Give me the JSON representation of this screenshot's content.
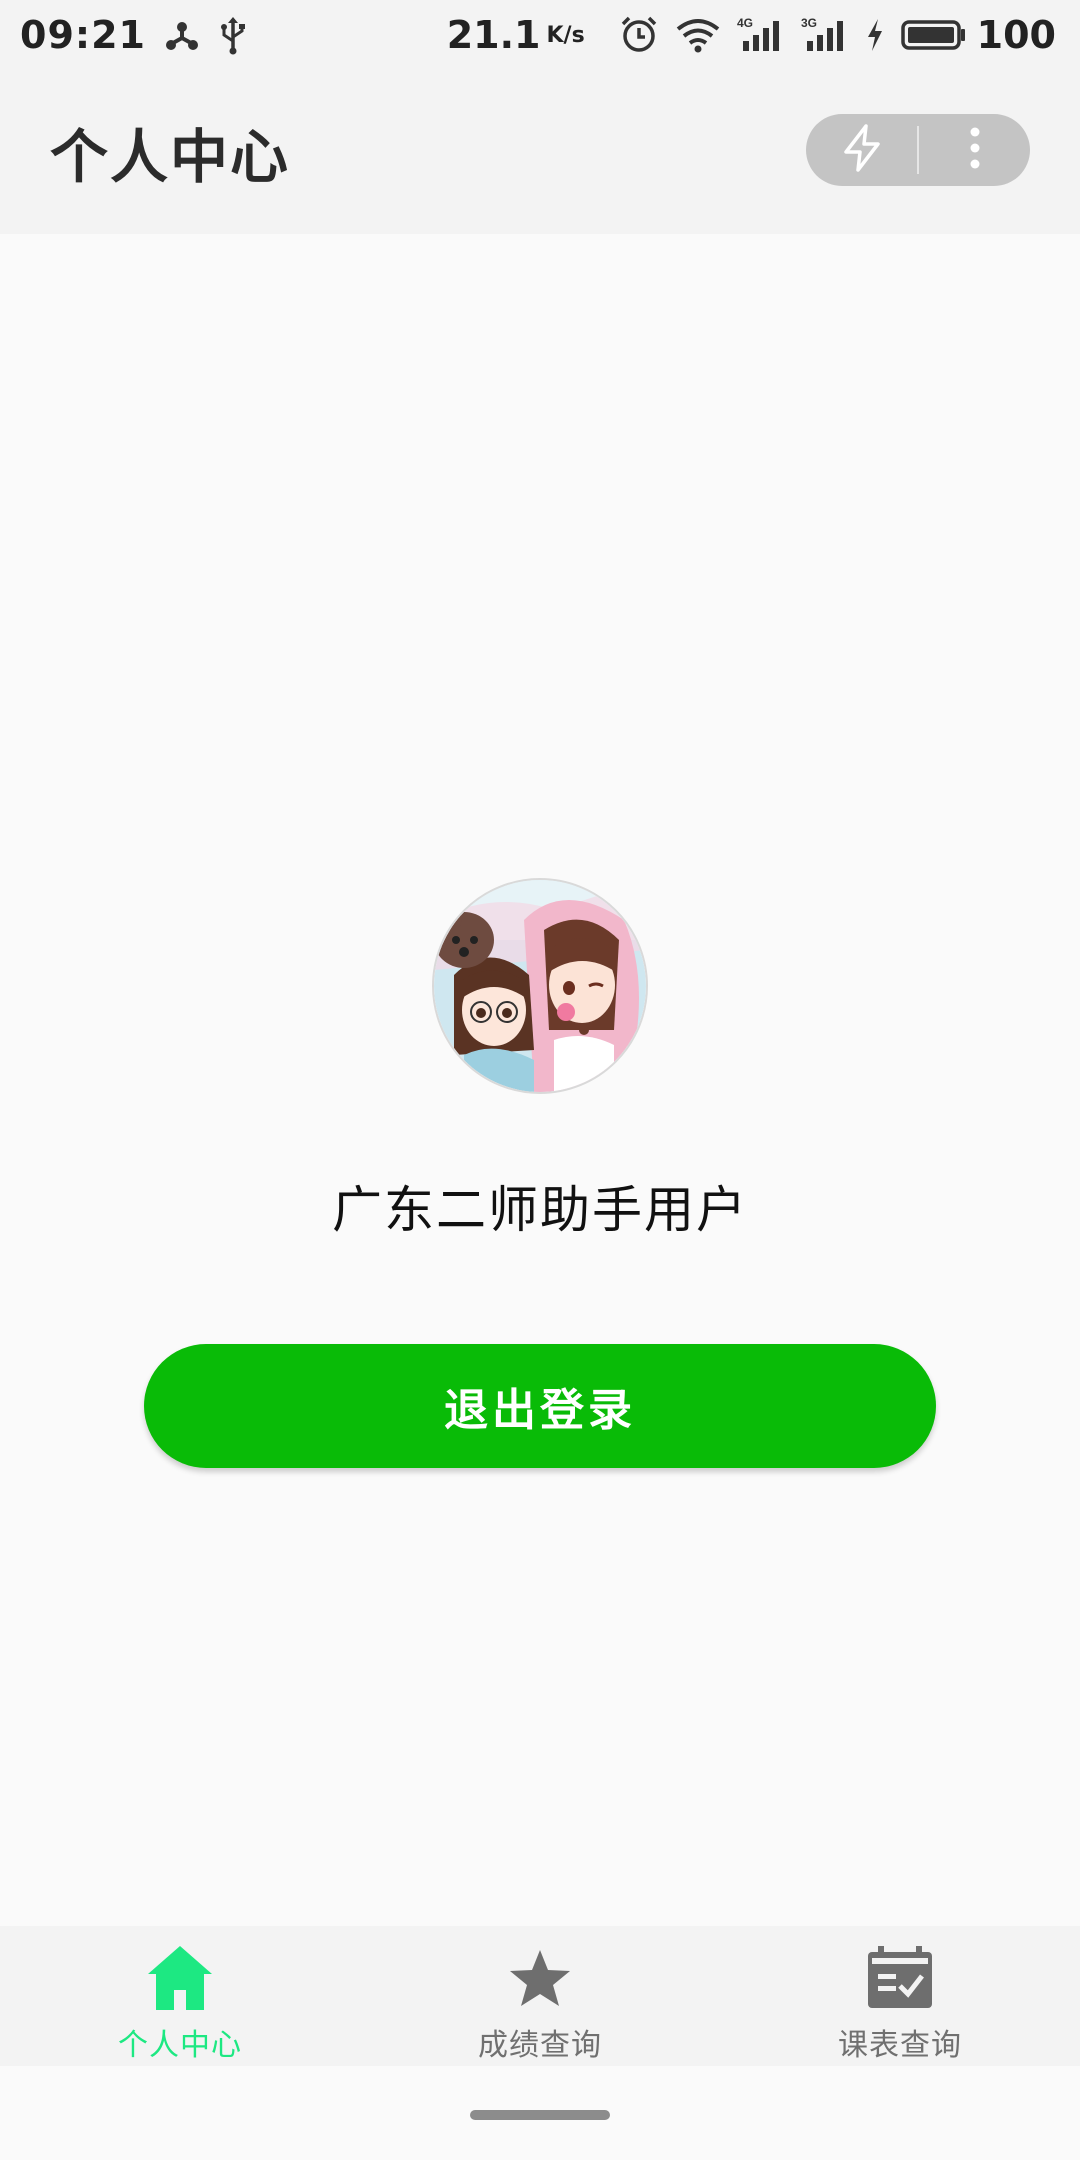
{
  "status_bar": {
    "time": "09:21",
    "net_speed": "21.1",
    "net_unit": "K/s",
    "battery": "100",
    "icons": [
      "hub-icon",
      "usb-icon",
      "alarm-icon",
      "wifi-icon",
      "signal-4g-icon",
      "signal-3g-icon",
      "charging-icon",
      "battery-icon"
    ]
  },
  "app_bar": {
    "title": "个人中心",
    "capsule_icons": [
      "flash-icon",
      "more-vert-icon"
    ]
  },
  "profile": {
    "avatar": "avatar-anime-icon",
    "username": "广东二师助手用户",
    "logout_label": "退出登录",
    "accent": "#09bb07"
  },
  "bottom_nav": {
    "items": [
      {
        "label": "个人中心",
        "icon": "home-icon",
        "active": true
      },
      {
        "label": "成绩查询",
        "icon": "star-icon",
        "active": false
      },
      {
        "label": "课表查询",
        "icon": "calendar-check-icon",
        "active": false
      }
    ],
    "active_color": "#1de882",
    "inactive_color": "#707070"
  }
}
